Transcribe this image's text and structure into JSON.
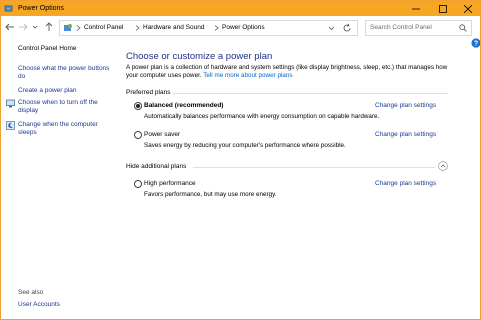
{
  "window": {
    "title": "Power Options",
    "accent_color": "#f5a623"
  },
  "address_bar": {
    "breadcrumbs": [
      "Control Panel",
      "Hardware and Sound",
      "Power Options"
    ],
    "search_placeholder": "Search Control Panel"
  },
  "sidebar": {
    "home": "Control Panel Home",
    "links": [
      {
        "label": "Choose what the power buttons do",
        "icon": "none"
      },
      {
        "label": "Create a power plan",
        "icon": "none"
      },
      {
        "label": "Choose when to turn off the display",
        "icon": "display-icon"
      },
      {
        "label": "Change when the computer sleeps",
        "icon": "moon-icon"
      }
    ],
    "see_also": "See also",
    "user_accounts": "User Accounts"
  },
  "main": {
    "heading": "Choose or customize a power plan",
    "description": "A power plan is a collection of hardware and system settings (like display brightness, sleep, etc.) that manages how your computer uses power.",
    "description_link": "Tell me more about power plans",
    "preferred_label": "Preferred plans",
    "hidden_label": "Hide additional plans",
    "change_label": "Change plan settings",
    "plans": [
      {
        "name": "Balanced (recommended)",
        "desc": "Automatically balances performance with energy consumption on capable hardware.",
        "selected": true
      },
      {
        "name": "Power saver",
        "desc": "Saves energy by reducing your computer's performance where possible.",
        "selected": false
      },
      {
        "name": "High performance",
        "desc": "Favors performance, but may use more energy.",
        "selected": false
      }
    ]
  }
}
